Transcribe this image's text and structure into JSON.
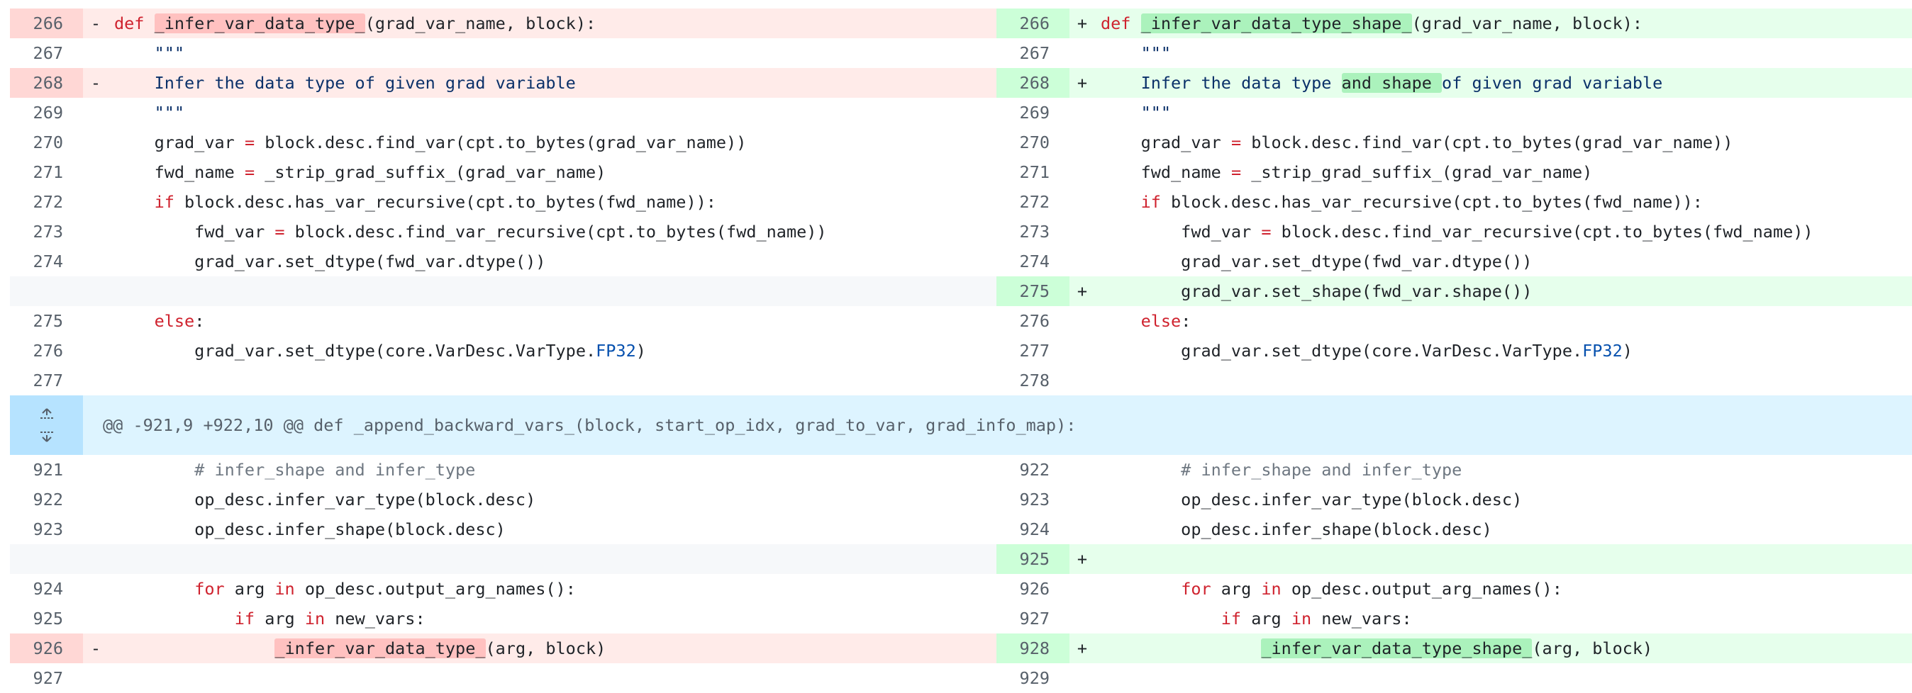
{
  "hunk_header": "@@ -921,9 +922,10 @@ def _append_backward_vars_(block, start_op_idx, grad_to_var, grad_info_map):",
  "rows": [
    {
      "left": {
        "type": "del",
        "num": "266",
        "sign": "-",
        "segs": [
          {
            "t": "kw",
            "v": "def "
          },
          {
            "t": "hl",
            "v": "_infer_var_data_type_"
          },
          {
            "t": "p",
            "v": "(grad_var_name, block):"
          }
        ]
      },
      "right": {
        "type": "add",
        "num": "266",
        "sign": "+",
        "segs": [
          {
            "t": "kw",
            "v": "def "
          },
          {
            "t": "hl",
            "v": "_infer_var_data_type_shape_"
          },
          {
            "t": "p",
            "v": "(grad_var_name, block):"
          }
        ]
      }
    },
    {
      "left": {
        "type": "ctx",
        "num": "267",
        "sign": "",
        "segs": [
          {
            "t": "str",
            "v": "    \"\"\""
          }
        ]
      },
      "right": {
        "type": "ctx",
        "num": "267",
        "sign": "",
        "segs": [
          {
            "t": "str",
            "v": "    \"\"\""
          }
        ]
      }
    },
    {
      "left": {
        "type": "del",
        "num": "268",
        "sign": "-",
        "segs": [
          {
            "t": "str",
            "v": "    Infer the data type of given grad variable"
          }
        ]
      },
      "right": {
        "type": "add",
        "num": "268",
        "sign": "+",
        "segs": [
          {
            "t": "str",
            "v": "    Infer the data type "
          },
          {
            "t": "hl",
            "v": "and shape "
          },
          {
            "t": "str",
            "v": "of given grad variable"
          }
        ]
      }
    },
    {
      "left": {
        "type": "ctx",
        "num": "269",
        "sign": "",
        "segs": [
          {
            "t": "str",
            "v": "    \"\"\""
          }
        ]
      },
      "right": {
        "type": "ctx",
        "num": "269",
        "sign": "",
        "segs": [
          {
            "t": "str",
            "v": "    \"\"\""
          }
        ]
      }
    },
    {
      "left": {
        "type": "ctx",
        "num": "270",
        "sign": "",
        "segs": [
          {
            "t": "p",
            "v": "    grad_var "
          },
          {
            "t": "kw",
            "v": "="
          },
          {
            "t": "p",
            "v": " block.desc.find_var(cpt.to_bytes(grad_var_name))"
          }
        ]
      },
      "right": {
        "type": "ctx",
        "num": "270",
        "sign": "",
        "segs": [
          {
            "t": "p",
            "v": "    grad_var "
          },
          {
            "t": "kw",
            "v": "="
          },
          {
            "t": "p",
            "v": " block.desc.find_var(cpt.to_bytes(grad_var_name))"
          }
        ]
      }
    },
    {
      "left": {
        "type": "ctx",
        "num": "271",
        "sign": "",
        "segs": [
          {
            "t": "p",
            "v": "    fwd_name "
          },
          {
            "t": "kw",
            "v": "="
          },
          {
            "t": "p",
            "v": " _strip_grad_suffix_(grad_var_name)"
          }
        ]
      },
      "right": {
        "type": "ctx",
        "num": "271",
        "sign": "",
        "segs": [
          {
            "t": "p",
            "v": "    fwd_name "
          },
          {
            "t": "kw",
            "v": "="
          },
          {
            "t": "p",
            "v": " _strip_grad_suffix_(grad_var_name)"
          }
        ]
      }
    },
    {
      "left": {
        "type": "ctx",
        "num": "272",
        "sign": "",
        "segs": [
          {
            "t": "p",
            "v": "    "
          },
          {
            "t": "kw",
            "v": "if"
          },
          {
            "t": "p",
            "v": " block.desc.has_var_recursive(cpt.to_bytes(fwd_name)):"
          }
        ]
      },
      "right": {
        "type": "ctx",
        "num": "272",
        "sign": "",
        "segs": [
          {
            "t": "p",
            "v": "    "
          },
          {
            "t": "kw",
            "v": "if"
          },
          {
            "t": "p",
            "v": " block.desc.has_var_recursive(cpt.to_bytes(fwd_name)):"
          }
        ]
      }
    },
    {
      "left": {
        "type": "ctx",
        "num": "273",
        "sign": "",
        "segs": [
          {
            "t": "p",
            "v": "        fwd_var "
          },
          {
            "t": "kw",
            "v": "="
          },
          {
            "t": "p",
            "v": " block.desc.find_var_recursive(cpt.to_bytes(fwd_name))"
          }
        ]
      },
      "right": {
        "type": "ctx",
        "num": "273",
        "sign": "",
        "segs": [
          {
            "t": "p",
            "v": "        fwd_var "
          },
          {
            "t": "kw",
            "v": "="
          },
          {
            "t": "p",
            "v": " block.desc.find_var_recursive(cpt.to_bytes(fwd_name))"
          }
        ]
      }
    },
    {
      "left": {
        "type": "ctx",
        "num": "274",
        "sign": "",
        "segs": [
          {
            "t": "p",
            "v": "        grad_var.set_dtype(fwd_var.dtype())"
          }
        ]
      },
      "right": {
        "type": "ctx",
        "num": "274",
        "sign": "",
        "segs": [
          {
            "t": "p",
            "v": "        grad_var.set_dtype(fwd_var.dtype())"
          }
        ]
      }
    },
    {
      "left": {
        "type": "empty",
        "num": "",
        "sign": "",
        "segs": []
      },
      "right": {
        "type": "add",
        "num": "275",
        "sign": "+",
        "segs": [
          {
            "t": "p",
            "v": "        grad_var.set_shape(fwd_var.shape())"
          }
        ]
      }
    },
    {
      "left": {
        "type": "ctx",
        "num": "275",
        "sign": "",
        "segs": [
          {
            "t": "p",
            "v": "    "
          },
          {
            "t": "kw",
            "v": "else"
          },
          {
            "t": "p",
            "v": ":"
          }
        ]
      },
      "right": {
        "type": "ctx",
        "num": "276",
        "sign": "",
        "segs": [
          {
            "t": "p",
            "v": "    "
          },
          {
            "t": "kw",
            "v": "else"
          },
          {
            "t": "p",
            "v": ":"
          }
        ]
      }
    },
    {
      "left": {
        "type": "ctx",
        "num": "276",
        "sign": "",
        "segs": [
          {
            "t": "p",
            "v": "        grad_var.set_dtype(core.VarDesc.VarType."
          },
          {
            "t": "const",
            "v": "FP32"
          },
          {
            "t": "p",
            "v": ")"
          }
        ]
      },
      "right": {
        "type": "ctx",
        "num": "277",
        "sign": "",
        "segs": [
          {
            "t": "p",
            "v": "        grad_var.set_dtype(core.VarDesc.VarType."
          },
          {
            "t": "const",
            "v": "FP32"
          },
          {
            "t": "p",
            "v": ")"
          }
        ]
      }
    },
    {
      "left": {
        "type": "ctx",
        "num": "277",
        "sign": "",
        "segs": []
      },
      "right": {
        "type": "ctx",
        "num": "278",
        "sign": "",
        "segs": []
      }
    },
    {
      "hunk": true
    },
    {
      "left": {
        "type": "ctx",
        "num": "921",
        "sign": "",
        "segs": [
          {
            "t": "cm",
            "v": "        # infer_shape and infer_type"
          }
        ]
      },
      "right": {
        "type": "ctx",
        "num": "922",
        "sign": "",
        "segs": [
          {
            "t": "cm",
            "v": "        # infer_shape and infer_type"
          }
        ]
      }
    },
    {
      "left": {
        "type": "ctx",
        "num": "922",
        "sign": "",
        "segs": [
          {
            "t": "p",
            "v": "        op_desc.infer_var_type(block.desc)"
          }
        ]
      },
      "right": {
        "type": "ctx",
        "num": "923",
        "sign": "",
        "segs": [
          {
            "t": "p",
            "v": "        op_desc.infer_var_type(block.desc)"
          }
        ]
      }
    },
    {
      "left": {
        "type": "ctx",
        "num": "923",
        "sign": "",
        "segs": [
          {
            "t": "p",
            "v": "        op_desc.infer_shape(block.desc)"
          }
        ]
      },
      "right": {
        "type": "ctx",
        "num": "924",
        "sign": "",
        "segs": [
          {
            "t": "p",
            "v": "        op_desc.infer_shape(block.desc)"
          }
        ]
      }
    },
    {
      "left": {
        "type": "empty",
        "num": "",
        "sign": "",
        "segs": []
      },
      "right": {
        "type": "add",
        "num": "925",
        "sign": "+",
        "segs": []
      }
    },
    {
      "left": {
        "type": "ctx",
        "num": "924",
        "sign": "",
        "segs": [
          {
            "t": "p",
            "v": "        "
          },
          {
            "t": "kw",
            "v": "for"
          },
          {
            "t": "p",
            "v": " arg "
          },
          {
            "t": "kw",
            "v": "in"
          },
          {
            "t": "p",
            "v": " op_desc.output_arg_names():"
          }
        ]
      },
      "right": {
        "type": "ctx",
        "num": "926",
        "sign": "",
        "segs": [
          {
            "t": "p",
            "v": "        "
          },
          {
            "t": "kw",
            "v": "for"
          },
          {
            "t": "p",
            "v": " arg "
          },
          {
            "t": "kw",
            "v": "in"
          },
          {
            "t": "p",
            "v": " op_desc.output_arg_names():"
          }
        ]
      }
    },
    {
      "left": {
        "type": "ctx",
        "num": "925",
        "sign": "",
        "segs": [
          {
            "t": "p",
            "v": "            "
          },
          {
            "t": "kw",
            "v": "if"
          },
          {
            "t": "p",
            "v": " arg "
          },
          {
            "t": "kw",
            "v": "in"
          },
          {
            "t": "p",
            "v": " new_vars:"
          }
        ]
      },
      "right": {
        "type": "ctx",
        "num": "927",
        "sign": "",
        "segs": [
          {
            "t": "p",
            "v": "            "
          },
          {
            "t": "kw",
            "v": "if"
          },
          {
            "t": "p",
            "v": " arg "
          },
          {
            "t": "kw",
            "v": "in"
          },
          {
            "t": "p",
            "v": " new_vars:"
          }
        ]
      }
    },
    {
      "left": {
        "type": "del",
        "num": "926",
        "sign": "-",
        "segs": [
          {
            "t": "p",
            "v": "                "
          },
          {
            "t": "hl",
            "v": "_infer_var_data_type_"
          },
          {
            "t": "p",
            "v": "(arg, block)"
          }
        ]
      },
      "right": {
        "type": "add",
        "num": "928",
        "sign": "+",
        "segs": [
          {
            "t": "p",
            "v": "                "
          },
          {
            "t": "hl",
            "v": "_infer_var_data_type_shape_"
          },
          {
            "t": "p",
            "v": "(arg, block)"
          }
        ]
      }
    },
    {
      "left": {
        "type": "ctx",
        "num": "927",
        "sign": "",
        "segs": []
      },
      "right": {
        "type": "ctx",
        "num": "929",
        "sign": "",
        "segs": []
      }
    }
  ]
}
